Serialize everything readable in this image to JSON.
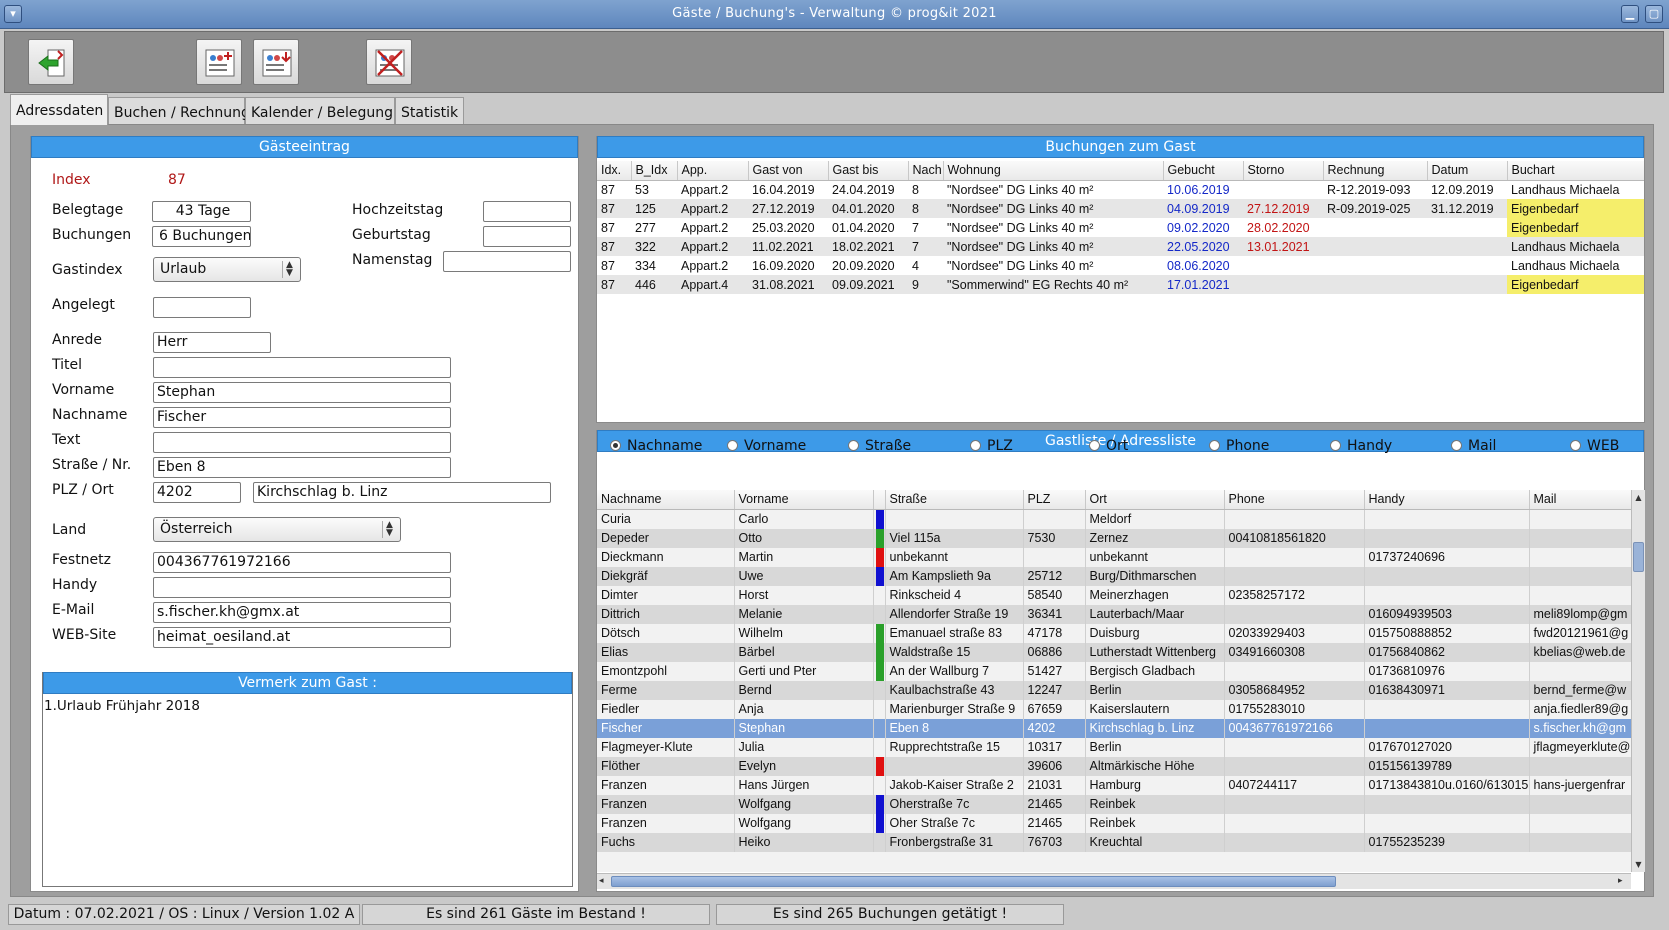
{
  "window": {
    "title": "Gäste / Buchung's - Verwaltung ©    prog&it 2021"
  },
  "tabs": [
    "Adressdaten",
    "Buchen / Rechnung",
    "Kalender / Belegung",
    "Statistik"
  ],
  "guest": {
    "header": "Gästeeintrag",
    "index_label": "Index",
    "index_value": "87",
    "belegtage_label": "Belegtage",
    "belegtage_value": "43 Tage",
    "buchungen_label": "Buchungen",
    "buchungen_value": "6 Buchungen",
    "gastindex_label": "Gastindex",
    "gastindex_value": "Urlaub",
    "hochzeitstag_label": "Hochzeitstag",
    "hochzeitstag_value": "",
    "geburtstag_label": "Geburtstag",
    "geburtstag_value": "",
    "namenstag_label": "Namenstag",
    "namenstag_value": "",
    "angelegt_label": "Angelegt",
    "angelegt_value": "",
    "anrede_label": "Anrede",
    "anrede_value": "Herr",
    "titel_label": "Titel",
    "titel_value": "",
    "vorname_label": "Vorname",
    "vorname_value": "Stephan",
    "nachname_label": "Nachname",
    "nachname_value": "Fischer",
    "text_label": "Text",
    "text_value": "",
    "strasse_label": "Straße / Nr.",
    "strasse_value": "Eben 8",
    "plzort_label": "PLZ / Ort",
    "plz_value": "4202",
    "ort_value": "Kirchschlag b. Linz",
    "land_label": "Land",
    "land_value": "Österreich",
    "festnetz_label": "Festnetz",
    "festnetz_value": "004367761972166",
    "handy_label": "Handy",
    "handy_value": "",
    "email_label": "E-Mail",
    "email_value": "s.fischer.kh@gmx.at",
    "web_label": "WEB-Site",
    "web_value": "heimat_oesiland.at",
    "vermerk_header": "Vermerk zum Gast :",
    "vermerk_text": "1.Urlaub Frühjahr 2018"
  },
  "bookings": {
    "header": "Buchungen zum Gast",
    "columns": [
      "Idx.",
      "B_Idx",
      "App.",
      "Gast von",
      "Gast bis",
      "Nach",
      "Wohnung",
      "Gebucht",
      "Storno",
      "Rechnung",
      "Datum",
      "Buchart"
    ],
    "rows": [
      [
        "87",
        "53",
        "Appart.2",
        "16.04.2019",
        "24.04.2019",
        "8",
        "\"Nordsee\"  DG Links 40 m²",
        "10.06.2019",
        "",
        "R-12.2019-093",
        "12.09.2019",
        "Landhaus Michaela"
      ],
      [
        "87",
        "125",
        "Appart.2",
        "27.12.2019",
        "04.01.2020",
        "8",
        "\"Nordsee\"  DG Links 40 m²",
        "04.09.2019",
        "27.12.2019",
        "R-09.2019-025",
        "31.12.2019",
        "Eigenbedarf"
      ],
      [
        "87",
        "277",
        "Appart.2",
        "25.03.2020",
        "01.04.2020",
        "7",
        "\"Nordsee\"  DG Links 40 m²",
        "09.02.2020",
        "28.02.2020",
        "",
        "",
        "Eigenbedarf"
      ],
      [
        "87",
        "322",
        "Appart.2",
        "11.02.2021",
        "18.02.2021",
        "7",
        "\"Nordsee\"  DG Links 40 m²",
        "22.05.2020",
        "13.01.2021",
        "",
        "",
        "Landhaus Michaela"
      ],
      [
        "87",
        "334",
        "Appart.2",
        "16.09.2020",
        "20.09.2020",
        "4",
        "\"Nordsee\"  DG Links 40 m²",
        "08.06.2020",
        "",
        "",
        "",
        "Landhaus Michaela"
      ],
      [
        "87",
        "446",
        "Appart.4",
        "31.08.2021",
        "09.09.2021",
        "9",
        "\"Sommerwind\"  EG Rechts 40 m²",
        "17.01.2021",
        "",
        "",
        "",
        "Eigenbedarf"
      ]
    ]
  },
  "guestlist": {
    "header": "Gastliste / Adressliste",
    "radios": [
      "Nachname",
      "Vorname",
      "Straße",
      "PLZ",
      "Ort",
      "Phone",
      "Handy",
      "Mail",
      "WEB"
    ],
    "selected_radio": "Nachname",
    "columns": [
      "Nachname",
      "Vorname",
      "",
      "Straße",
      "PLZ",
      "Ort",
      "Phone",
      "Handy",
      "Mail"
    ],
    "rows": [
      [
        "Curia",
        "Carlo",
        "#1010d0",
        "",
        "",
        "Meldorf",
        "",
        "",
        ""
      ],
      [
        "Depeder",
        "Otto",
        "#2aa02a",
        "Viel 115a",
        "7530",
        "Zernez",
        "00410818561820",
        "",
        ""
      ],
      [
        "Dieckmann",
        "Martin",
        "#e01010",
        "unbekannt",
        "",
        "unbekannt",
        "",
        "01737240696",
        ""
      ],
      [
        "Diekgräf",
        "Uwe",
        "#1010d0",
        "Am Kampslieth 9a",
        "25712",
        "Burg/Dithmarschen",
        "",
        "",
        ""
      ],
      [
        "Dimter",
        "Horst",
        "",
        "Rinkscheid 4",
        "58540",
        "Meinerzhagen",
        "02358257172",
        "",
        ""
      ],
      [
        "Dittrich",
        "Melanie",
        "",
        "Allendorfer Straße 19",
        "36341",
        "Lauterbach/Maar",
        "",
        "016094939503",
        "meli89lomp@gm"
      ],
      [
        "Dötsch",
        "Wilhelm",
        "#2aa02a",
        "Emanuael straße 83",
        "47178",
        "Duisburg",
        "02033929403",
        "015750888852",
        "fwd20121961@g"
      ],
      [
        "Elias",
        "Bärbel",
        "#2aa02a",
        "Waldstraße 15",
        "06886",
        "Lutherstadt Wittenberg",
        "03491660308",
        "01756840862",
        "kbelias@web.de"
      ],
      [
        "Emontzpohl",
        "Gerti und Pter",
        "#2aa02a",
        "An der Wallburg 7",
        "51427",
        "Bergisch Gladbach",
        "",
        "01736810976",
        ""
      ],
      [
        "Ferme",
        "Bernd",
        "",
        "Kaulbachstraße 43",
        "12247",
        "Berlin",
        "03058684952",
        "01638430971",
        "bernd_ferme@w"
      ],
      [
        "Fiedler",
        "Anja",
        "",
        "Marienburger Straße 9",
        "67659",
        "Kaiserslautern",
        "01755283010",
        "",
        "anja.fiedler89@g"
      ],
      [
        "Fischer",
        "Stephan",
        "",
        "Eben 8",
        "4202",
        "Kirchschlag b. Linz",
        "004367761972166",
        "",
        "s.fischer.kh@gm"
      ],
      [
        "Flagmeyer-Klute",
        "Julia",
        "",
        "Rupprechtstraße 15",
        "10317",
        "Berlin",
        "",
        "017670127020",
        "jflagmeyerklute@"
      ],
      [
        "Flöther",
        "Evelyn",
        "#e01010",
        "",
        "39606",
        "Altmärkische Höhe",
        "",
        "015156139789",
        ""
      ],
      [
        "Franzen",
        "Hans Jürgen",
        "",
        "Jakob-Kaiser Straße 2",
        "21031",
        "Hamburg",
        "0407244117",
        "01713843810u.0160/613015",
        "hans-juergenfrar"
      ],
      [
        "Franzen",
        "Wolfgang",
        "#1010d0",
        "Oherstraße 7c",
        "21465",
        "Reinbek",
        "",
        "",
        ""
      ],
      [
        "Franzen",
        "Wolfgang",
        "#1010d0",
        "Oher Straße 7c",
        "21465",
        "Reinbek",
        "",
        "",
        ""
      ],
      [
        "Fuchs",
        "Heiko",
        "",
        "Fronbergstraße 31",
        "76703",
        "Kreuchtal",
        "",
        "01755235239",
        ""
      ]
    ],
    "selected_row": 11
  },
  "status": {
    "left": "Datum : 07.02.2021 / OS : Linux  /  Version 1.02 A",
    "middle": "Es sind 261 Gäste im Bestand !",
    "right": "Es sind 265 Buchungen getätigt !"
  },
  "icons": [
    "exit-icon",
    "add-guest-icon",
    "import-guest-icon",
    "delete-guest-icon"
  ]
}
